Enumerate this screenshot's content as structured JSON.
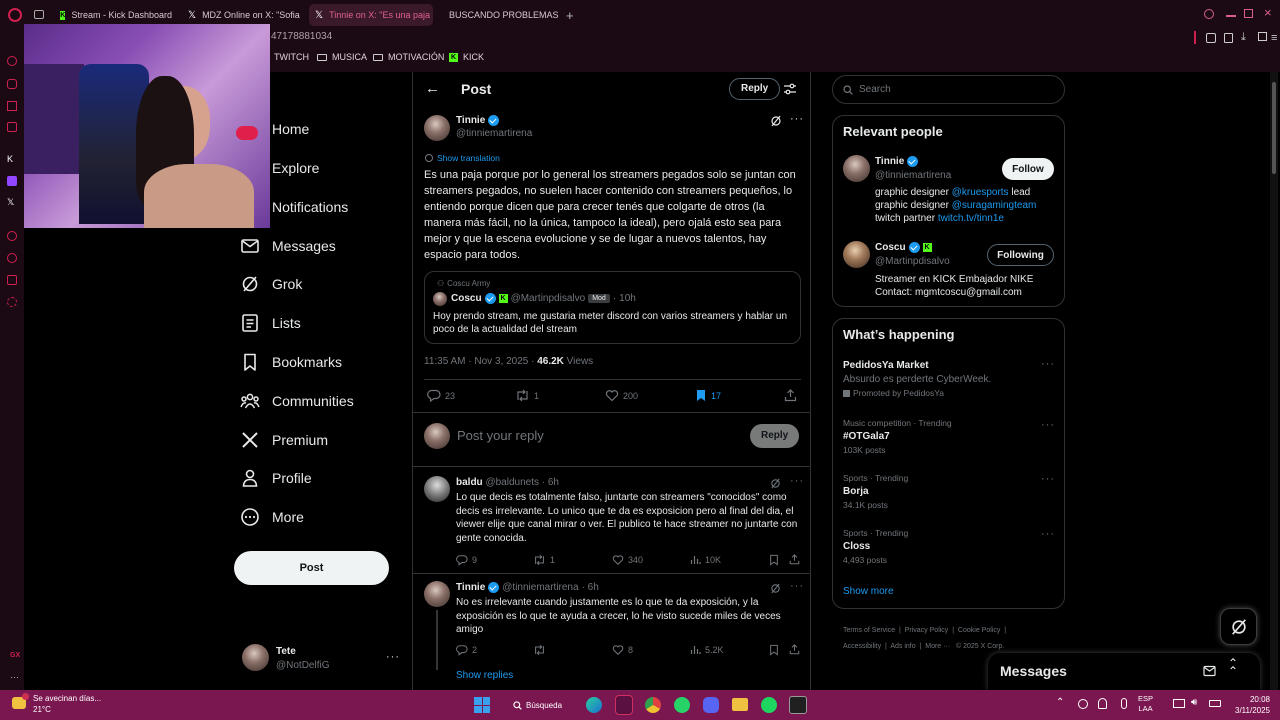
{
  "browser": {
    "tabs": [
      {
        "label": "Stream - Kick Dashboard",
        "icon": "kick-icon"
      },
      {
        "label": "MDZ Online on X: \"Sofia",
        "icon": "x-icon"
      },
      {
        "label": "Tinnie on X: \"Es una paja",
        "icon": "x-icon"
      },
      {
        "label": "BUSCANDO PROBLEMAS",
        "icon": "youtube-icon"
      }
    ],
    "address_fragment": "47178881034",
    "bookmarks": [
      "TWITCH",
      "MUSICA",
      "MOTIVACIÓN",
      "KICK"
    ]
  },
  "nav": {
    "items": [
      {
        "label": "Home",
        "icon": "home-icon"
      },
      {
        "label": "Explore",
        "icon": "search-icon"
      },
      {
        "label": "Notifications",
        "icon": "bell-icon"
      },
      {
        "label": "Messages",
        "icon": "mail-icon"
      },
      {
        "label": "Grok",
        "icon": "grok-icon"
      },
      {
        "label": "Lists",
        "icon": "list-icon"
      },
      {
        "label": "Bookmarks",
        "icon": "bookmark-icon"
      },
      {
        "label": "Communities",
        "icon": "communities-icon"
      },
      {
        "label": "Premium",
        "icon": "x-logo-icon"
      },
      {
        "label": "Profile",
        "icon": "profile-icon"
      },
      {
        "label": "More",
        "icon": "more-circle-icon"
      }
    ],
    "post_button": "Post",
    "account": {
      "name": "Tete",
      "handle": "@NotDelfiG"
    }
  },
  "header": {
    "title": "Post",
    "reply_button": "Reply"
  },
  "post": {
    "name": "Tinnie",
    "handle": "@tinniemartirena",
    "show_translation": "Show translation",
    "text": "Es una paja porque por lo general los streamers pegados solo se juntan con streamers pegados, no suelen hacer contenido con streamers pequeños, lo entiendo porque dicen que para crecer tenés que colgarte de otros (la manera más fácil, no la única, tampoco la ideal), pero ojalá esto sea para mejor y que la escena evolucione y se de lugar a nuevos talentos, hay espacio para todos.",
    "quote": {
      "community": "Coscu Army",
      "name": "Coscu",
      "handle": "@Martinpdisalvo",
      "badge": "Mod",
      "time": "10h",
      "text": "Hoy prendo stream, me gustaria meter discord con varios streamers y hablar un poco de la actualidad del stream"
    },
    "timestamp": "11:35 AM · Nov 3, 2025 · ",
    "views_count": "46.2K",
    "views_label": " Views",
    "stats": {
      "replies": "23",
      "reposts": "1",
      "likes": "200",
      "bookmarks": "17"
    }
  },
  "reply_composer": {
    "placeholder": "Post your reply",
    "button": "Reply"
  },
  "replies": [
    {
      "name": "baldu",
      "handle": "@baldunets",
      "time": "· 6h",
      "text": "Lo que decis es totalmente falso, juntarte con streamers \"conocidos\" como decis es irrelevante. Lo unico que te da es exposicion pero al final del dia, el viewer elije que canal mirar o ver. El publico te hace streamer no juntarte con gente conocida.",
      "stats": {
        "replies": "9",
        "reposts": "1",
        "likes": "340",
        "views": "10K"
      }
    },
    {
      "name": "Tinnie",
      "handle": "@tinniemartirena",
      "time": "· 6h",
      "text": "No es irrelevante cuando justamente es lo que te da exposición, y la exposición es lo que te ayuda a crecer, lo he visto sucede miles de veces amigo",
      "stats": {
        "replies": "2",
        "reposts": "",
        "likes": "8",
        "views": "5.2K"
      }
    }
  ],
  "show_replies": "Show replies",
  "sidebar": {
    "search_placeholder": "Search",
    "relevant_title": "Relevant people",
    "people": [
      {
        "name": "Tinnie",
        "handle": "@tinniemartirena",
        "button": "Follow",
        "bio1_a": "graphic designer ",
        "bio1_link": "@kruesports",
        "bio1_b": " lead",
        "bio2_a": "graphic designer ",
        "bio2_link": "@suragamingteam",
        "bio3_a": "twitch partner ",
        "bio3_link": "twitch.tv/tinn1e"
      },
      {
        "name": "Coscu",
        "handle": "@Martinpdisalvo",
        "button": "Following",
        "bio1": "Streamer en KICK Embajador NIKE",
        "bio2": "Contact: mgmtcoscu@gmail.com"
      }
    ],
    "happening_title": "What’s happening",
    "trends": [
      {
        "title": "PedidosYa Market",
        "sub": "Absurdo es perderte CyberWeek.",
        "meta": "Promoted by PedidosYa"
      },
      {
        "meta": "Music competition · Trending",
        "title": "#OTGala7",
        "count": "103K posts"
      },
      {
        "meta": "Sports · Trending",
        "title": "Borja",
        "count": "34.1K posts"
      },
      {
        "meta": "Sports · Trending",
        "title": "Closs",
        "count": "4,493 posts"
      }
    ],
    "show_more": "Show more",
    "footer": [
      "Terms of Service",
      "Privacy Policy",
      "Cookie Policy",
      "Accessibility",
      "Ads info",
      "More ···",
      "© 2025 X Corp."
    ]
  },
  "messages_dock": {
    "title": "Messages"
  },
  "taskbar": {
    "weather_title": "Se avecinan días...",
    "weather_temp": "21°C",
    "search_label": "Búsqueda",
    "lang1": "ESP",
    "lang2": "LAA",
    "time": "20:08",
    "date": "3/11/2025"
  },
  "colors": {
    "accent": "#1d9bf0",
    "taskbar": "#7a1650",
    "chrome": "#1b0a14",
    "kick": "#53fc18"
  }
}
